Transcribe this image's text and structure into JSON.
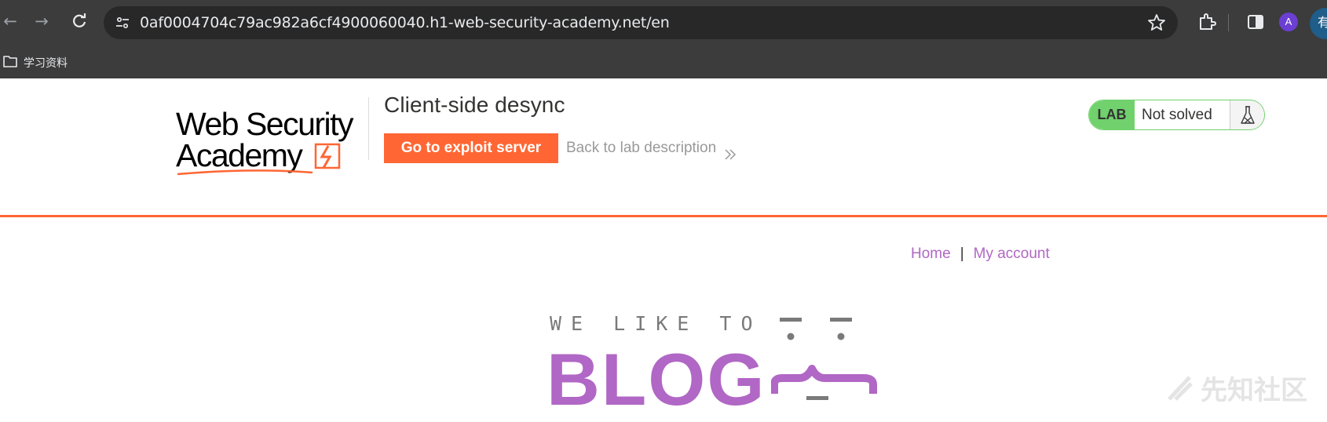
{
  "browser": {
    "url": "0af0004704c79ac982a6cf4900060040.h1-web-security-academy.net/en",
    "avatar_letter": "A",
    "profile_char": "有",
    "bookmarks": [
      {
        "label": "学习资料",
        "icon": "folder-icon"
      }
    ],
    "icons": [
      "back-arrow-icon",
      "forward-arrow-icon",
      "reload-icon",
      "site-info-icon",
      "star-icon",
      "extensions-icon",
      "side-panel-icon"
    ]
  },
  "lab": {
    "logo": {
      "line1": "Web Security",
      "line2": "Academy"
    },
    "title": "Client-side desync",
    "exploit_button": "Go to exploit server",
    "back_link": "Back to lab description",
    "status": {
      "badge": "LAB",
      "text": "Not solved",
      "icon": "flask-icon"
    },
    "colors": {
      "accent": "#ff6633",
      "solved_green": "#70d16d",
      "text": "#333332"
    }
  },
  "blog": {
    "nav": {
      "home": "Home",
      "separator": "|",
      "account": "My account"
    },
    "hero": {
      "tagline": "WE LIKE TO",
      "title": "BLOG"
    },
    "colors": {
      "purple": "#b167c5",
      "grey": "#7a7a7a"
    }
  },
  "watermark": {
    "text": "先知社区"
  }
}
